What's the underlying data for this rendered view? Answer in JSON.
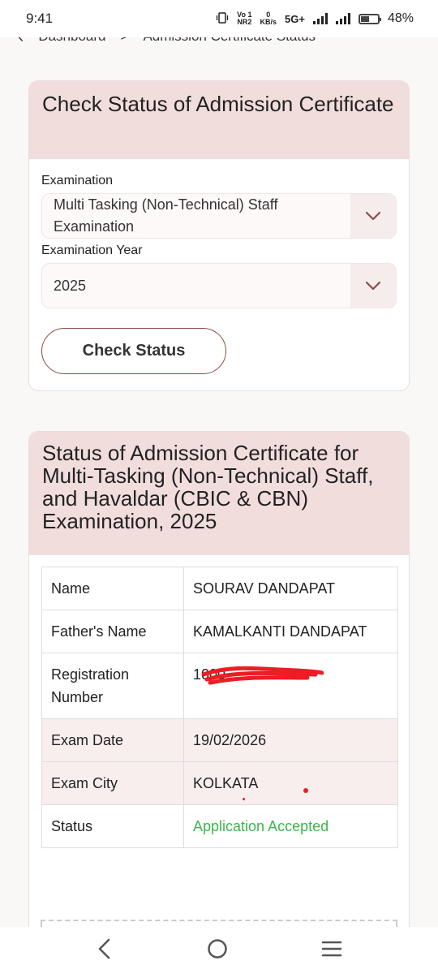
{
  "status_bar": {
    "time": "9:41",
    "volte_top": "Vo 1",
    "volte_bottom": "NR2",
    "speed_top": "0",
    "speed_bottom": "KB/s",
    "network": "5G+",
    "battery": "48%"
  },
  "breadcrumb": {
    "item1": "Dashboard",
    "separator": ">",
    "item2": "Admission Certificate Status"
  },
  "check_card": {
    "title": "Check Status of Admission Certificate",
    "exam_label": "Examination",
    "exam_value": "Multi Tasking (Non-Technical) Staff Examination",
    "year_label": "Examination Year",
    "year_value": "2025",
    "button": "Check Status"
  },
  "result_card": {
    "title": "Status of Admission Certificate for Multi-Tasking (Non-Technical) Staff, and Havaldar (CBIC & CBN) Examination, 2025",
    "rows": [
      {
        "key": "Name",
        "value": "SOURAV DANDAPAT"
      },
      {
        "key": "Father's Name",
        "value": "KAMALKANTI DANDAPAT"
      },
      {
        "key": "Registration Number",
        "value": "1000"
      },
      {
        "key": "Exam Date",
        "value": "19/02/2026"
      },
      {
        "key": "Exam City",
        "value": "KOLKATA"
      },
      {
        "key": "Status",
        "value": "Application Accepted"
      }
    ]
  },
  "colors": {
    "header_bg": "#f1dedc",
    "accent": "#8a4b45",
    "accepted": "#3cb54a"
  },
  "icons": {
    "back": "chevron-left-icon",
    "select": "chevron-down-icon",
    "nav_back": "nav-back-icon",
    "nav_home": "nav-home-icon",
    "nav_menu": "nav-menu-icon"
  }
}
